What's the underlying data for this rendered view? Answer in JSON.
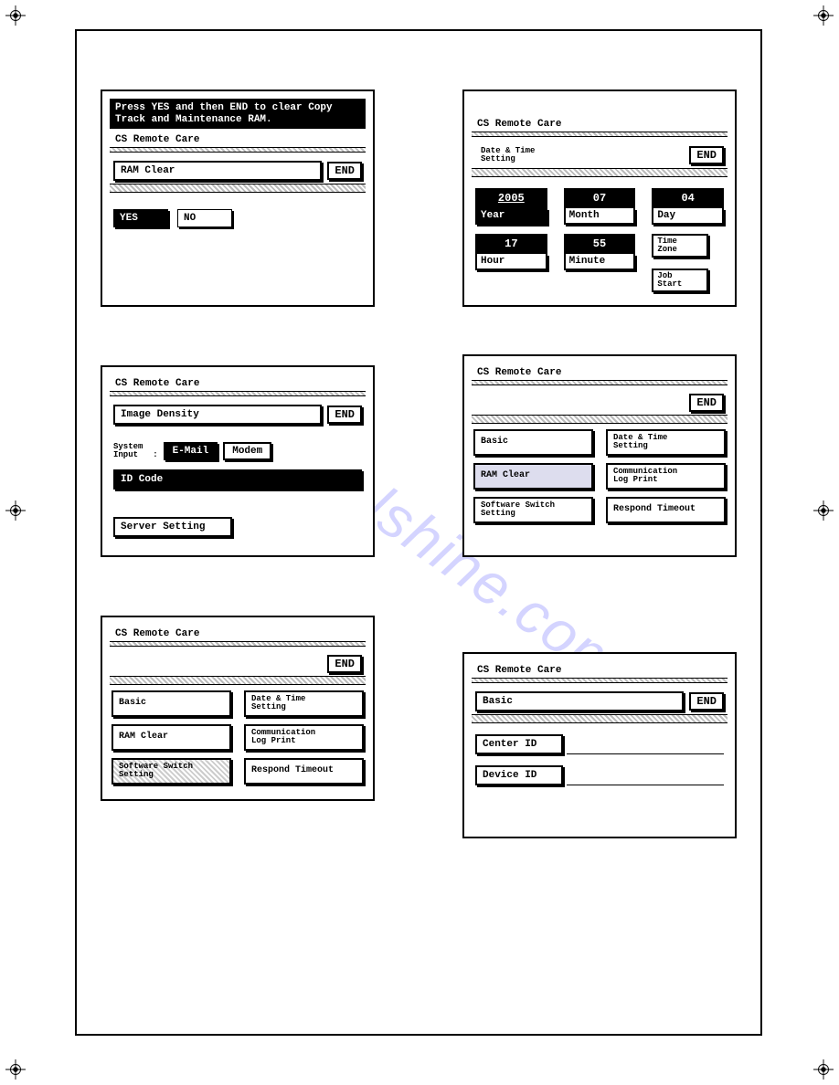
{
  "common": {
    "title": "CS Remote Care",
    "end": "END",
    "yes": "YES",
    "no": "NO"
  },
  "watermark": "manualshine.com",
  "screen1": {
    "instruction": "Press YES and then END to clear Copy Track and Maintenance RAM.",
    "subtitle": "RAM Clear"
  },
  "screen2": {
    "subtitle": "Date & Time\nSetting",
    "year_val": "2005",
    "year_lbl": "Year",
    "month_val": "07",
    "month_lbl": "Month",
    "day_val": "04",
    "day_lbl": "Day",
    "hour_val": "17",
    "hour_lbl": "Hour",
    "minute_val": "55",
    "minute_lbl": "Minute",
    "time_zone": "Time\nZone",
    "job_start": "Job\nStart"
  },
  "screen3": {
    "subtitle": "Image Density",
    "sys_label": "System\nInput   :",
    "email": "E-Mail",
    "modem": "Modem",
    "id_code": "ID Code",
    "server_setting": "Server Setting"
  },
  "screen_menu": {
    "basic": "Basic",
    "date_time": "Date & Time\nSetting",
    "ram_clear": "RAM Clear",
    "comm_log": "Communication\nLog Print",
    "sw_switch": "Software Switch\nSetting",
    "respond": "Respond Timeout"
  },
  "screen6": {
    "subtitle": "Basic",
    "center_id": "Center ID",
    "device_id": "Device ID"
  }
}
